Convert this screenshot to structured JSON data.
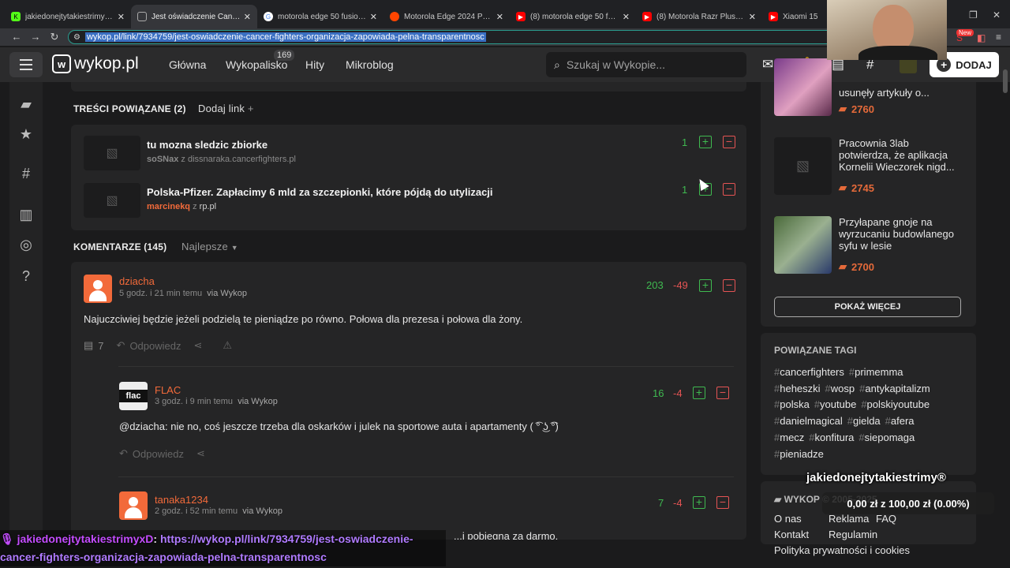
{
  "browser": {
    "tabs": [
      {
        "title": "jakiedonejtytakiestrimyxD",
        "icon": "kick-icon",
        "color": "#53fc18"
      },
      {
        "title": "Jest oświadczenie Cancer Fight",
        "icon": "wykop-icon",
        "color": "#777777"
      },
      {
        "title": "motorola edge 50 fusion pwm",
        "icon": "google-icon",
        "color": "#4285f4"
      },
      {
        "title": "Motorola Edge 2024 PWM : r/",
        "icon": "reddit-icon",
        "color": "#ff4500"
      },
      {
        "title": "(8) motorola edge 50 fusion p",
        "icon": "youtube-icon",
        "color": "#ff0000"
      },
      {
        "title": "(8) Motorola Razr Plus PWM v",
        "icon": "youtube-icon",
        "color": "#ff0000"
      },
      {
        "title": "Xiaomi 15",
        "icon": "youtube-icon",
        "color": "#ff0000"
      }
    ],
    "url": "wykop.pl/link/7934759/jest-oswiadczenie-cancer-fighters-organizacja-zapowiada-pelna-transparentnosc",
    "new_badge": "New"
  },
  "header": {
    "logo": "wykop.pl",
    "nav": [
      "Główna",
      "Wykopalisko",
      "Hity",
      "Mikroblog"
    ],
    "wykopalisko_count": "169",
    "search_placeholder": "Szukaj w Wykopie...",
    "add_label": "DODAJ"
  },
  "related": {
    "heading": "TREŚCI POWIĄZANE (2)",
    "add_link": "Dodaj link",
    "items": [
      {
        "title": "tu mozna sledzic zbiorke",
        "author": "soSNax",
        "sep": "z",
        "source": "dissnaraka.cancerfighters.pl",
        "votes": "1"
      },
      {
        "title": "Polska-Pfizer. Zapłacimy 6 mld za szczepionki, które pójdą do utylizacji",
        "author": "marcinekq",
        "sep": "z",
        "source": "rp.pl",
        "votes": "1"
      }
    ]
  },
  "comments": {
    "heading": "KOMENTARZE (145)",
    "sort": "Najlepsze",
    "reply_label": "Odpowiedz",
    "items": [
      {
        "user": "dziacha",
        "meta": "5 godz. i 21 min temu",
        "via": "via Wykop",
        "up": "203",
        "down": "-49",
        "text": "Najuczciwiej będzie jeżeli podzielą te pieniądze po równo. Połowa dla prezesa i połowa dla żony.",
        "replies": "7"
      },
      {
        "user": "FLAC",
        "meta": "3 godz. i 9 min temu",
        "via": "via Wykop",
        "up": "16",
        "down": "-4",
        "text": "@dziacha: nie no, coś jeszcze trzeba dla oskarków i julek na sportowe auta i apartamenty ( ͡° ͜ʖ ͡°)"
      },
      {
        "user": "tanaka1234",
        "meta": "2 godz. i 52 min temu",
        "via": "via Wykop",
        "up": "7",
        "down": "-4",
        "text": "...i pobiegną za darmo."
      }
    ]
  },
  "sidebar": {
    "articles": [
      {
        "title": "usunęły artykuły o...",
        "votes": "2760"
      },
      {
        "title": "Pracownia 3lab potwierdza, że aplikacja Kornelii Wieczorek nigd...",
        "votes": "2745"
      },
      {
        "title": "Przyłapane gnoje na wyrzucaniu budowlanego syfu w lesie",
        "votes": "2700"
      }
    ],
    "more_label": "POKAŻ WIĘCEJ",
    "tags_heading": "POWIĄZANE TAGI",
    "tags": [
      "cancerfighters",
      "primemma",
      "heheszki",
      "wosp",
      "antykapitalizm",
      "polska",
      "youtube",
      "polskiyoutube",
      "danielmagical",
      "gielda",
      "afera",
      "mecz",
      "konfitura",
      "siepomaga",
      "pieniadze"
    ],
    "footer_heading": "WYKOP © 2005-2025",
    "footer_links": [
      "O nas",
      "Reklama",
      "FAQ",
      "Kontakt",
      "Regulamin",
      "Polityka prywatności i cookies"
    ]
  },
  "stream": {
    "name": "jakiedonejtytakiestrimy®",
    "goal": "0,00 zł z 100,00 zł (0.00%)",
    "chat_user": "jakiedonejtytakiestrimyxD",
    "chat_link": "https://wykop.pl/link/7934759/jest-oswiadczenie-cancer-fighters-organizacja-zapowiada-pelna-transparentnosc"
  },
  "colors": {
    "accent": "#f26a3a",
    "plus": "#3fb950",
    "minus": "#e55454"
  }
}
